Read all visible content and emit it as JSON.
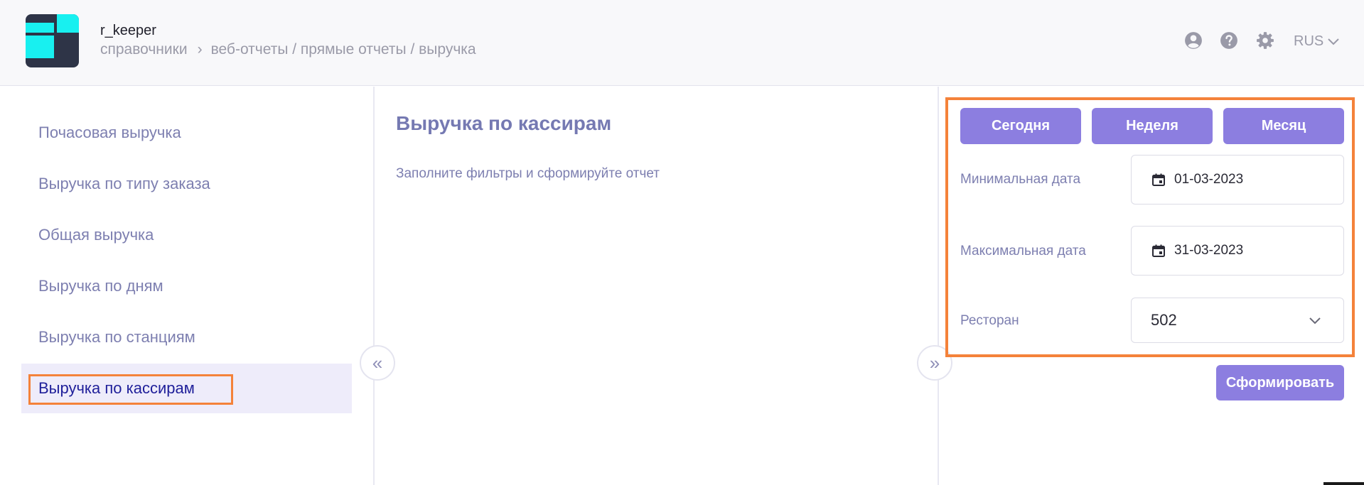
{
  "header": {
    "app_title": "r_keeper",
    "breadcrumb": {
      "root": "справочники",
      "separator": "›",
      "path": "веб-отчеты / прямые отчеты / выручка"
    },
    "icons": [
      "user-icon",
      "help-icon",
      "gear-icon"
    ],
    "language": "RUS"
  },
  "sidebar": {
    "items": [
      {
        "label": "Почасовая выручка",
        "active": false
      },
      {
        "label": "Выручка по типу заказа",
        "active": false
      },
      {
        "label": "Общая выручка",
        "active": false
      },
      {
        "label": "Выручка по дням",
        "active": false
      },
      {
        "label": "Выручка по станциям",
        "active": false
      },
      {
        "label": "Выручка по кассирам",
        "active": true
      }
    ],
    "collapse_glyph": "«"
  },
  "main": {
    "title": "Выручка по кассирам",
    "hint": "Заполните фильтры и сформируйте отчет",
    "expand_glyph": "»"
  },
  "filters": {
    "period_buttons": [
      "Сегодня",
      "Неделя",
      "Месяц"
    ],
    "min_date": {
      "label": "Минимальная дата",
      "value": "01-03-2023"
    },
    "max_date": {
      "label": "Максимальная дата",
      "value": "31-03-2023"
    },
    "restaurant": {
      "label": "Ресторан",
      "value": "502"
    },
    "submit_label": "Сформировать"
  },
  "colors": {
    "accent": "#8c7ee0",
    "highlight_outline": "#f4823a",
    "logo_cyan": "#18f0f0",
    "logo_dark": "#2e3447",
    "nav_text": "#7d7fb0",
    "active_text": "#1f1f9a",
    "active_bg": "#eeecfa"
  }
}
